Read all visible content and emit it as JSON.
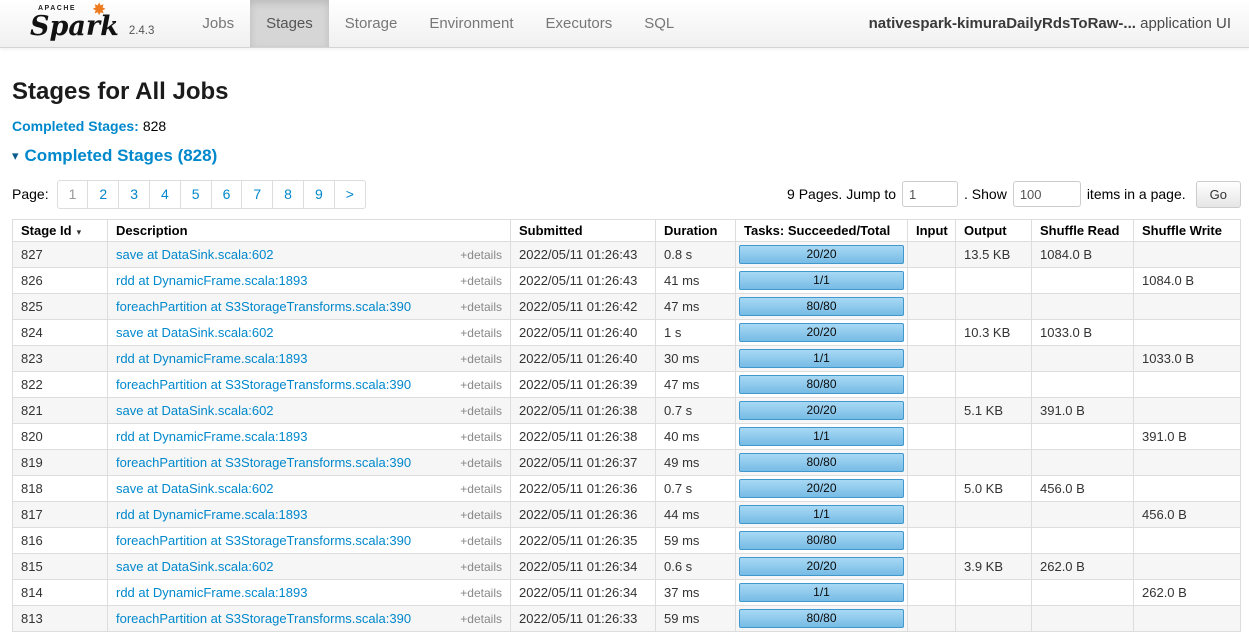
{
  "navbar": {
    "logo": {
      "apache": "APACHE",
      "name": "Spark",
      "version": "2.4.3"
    },
    "items": [
      {
        "label": "Jobs",
        "active": false
      },
      {
        "label": "Stages",
        "active": true
      },
      {
        "label": "Storage",
        "active": false
      },
      {
        "label": "Environment",
        "active": false
      },
      {
        "label": "Executors",
        "active": false
      },
      {
        "label": "SQL",
        "active": false
      }
    ],
    "app_name": "nativespark-kimuraDailyRdsToRaw-...",
    "app_suffix": "application UI"
  },
  "page": {
    "title": "Stages for All Jobs",
    "summary_label": "Completed Stages:",
    "summary_value": "828",
    "section_arrow": "▾",
    "section_title": "Completed Stages (828)"
  },
  "pagination": {
    "label": "Page:",
    "pages": [
      "1",
      "2",
      "3",
      "4",
      "5",
      "6",
      "7",
      "8",
      "9",
      ">"
    ],
    "current": "1",
    "right": {
      "pages_text": "9 Pages. Jump to",
      "jump_value": "1",
      "show_text": ". Show",
      "show_value": "100",
      "items_text": "items in a page.",
      "go_label": "Go"
    }
  },
  "colors": {
    "link_blue": "#0088cc",
    "progress_fill": "#77bbe5",
    "progress_border": "#4198cd",
    "active_tab": "#d6d6d6"
  },
  "table": {
    "columns": [
      "Stage Id",
      "Description",
      "Submitted",
      "Duration",
      "Tasks: Succeeded/Total",
      "Input",
      "Output",
      "Shuffle Read",
      "Shuffle Write"
    ],
    "sort_arrow": "▾",
    "details_label": "+details",
    "rows": [
      {
        "id": "827",
        "description": "save at DataSink.scala:602",
        "submitted": "2022/05/11 01:26:43",
        "duration": "0.8 s",
        "tasks": "20/20",
        "input": "",
        "output": "13.5 KB",
        "shuffle_read": "1084.0 B",
        "shuffle_write": ""
      },
      {
        "id": "826",
        "description": "rdd at DynamicFrame.scala:1893",
        "submitted": "2022/05/11 01:26:43",
        "duration": "41 ms",
        "tasks": "1/1",
        "input": "",
        "output": "",
        "shuffle_read": "",
        "shuffle_write": "1084.0 B"
      },
      {
        "id": "825",
        "description": "foreachPartition at S3StorageTransforms.scala:390",
        "submitted": "2022/05/11 01:26:42",
        "duration": "47 ms",
        "tasks": "80/80",
        "input": "",
        "output": "",
        "shuffle_read": "",
        "shuffle_write": ""
      },
      {
        "id": "824",
        "description": "save at DataSink.scala:602",
        "submitted": "2022/05/11 01:26:40",
        "duration": "1 s",
        "tasks": "20/20",
        "input": "",
        "output": "10.3 KB",
        "shuffle_read": "1033.0 B",
        "shuffle_write": ""
      },
      {
        "id": "823",
        "description": "rdd at DynamicFrame.scala:1893",
        "submitted": "2022/05/11 01:26:40",
        "duration": "30 ms",
        "tasks": "1/1",
        "input": "",
        "output": "",
        "shuffle_read": "",
        "shuffle_write": "1033.0 B"
      },
      {
        "id": "822",
        "description": "foreachPartition at S3StorageTransforms.scala:390",
        "submitted": "2022/05/11 01:26:39",
        "duration": "47 ms",
        "tasks": "80/80",
        "input": "",
        "output": "",
        "shuffle_read": "",
        "shuffle_write": ""
      },
      {
        "id": "821",
        "description": "save at DataSink.scala:602",
        "submitted": "2022/05/11 01:26:38",
        "duration": "0.7 s",
        "tasks": "20/20",
        "input": "",
        "output": "5.1 KB",
        "shuffle_read": "391.0 B",
        "shuffle_write": ""
      },
      {
        "id": "820",
        "description": "rdd at DynamicFrame.scala:1893",
        "submitted": "2022/05/11 01:26:38",
        "duration": "40 ms",
        "tasks": "1/1",
        "input": "",
        "output": "",
        "shuffle_read": "",
        "shuffle_write": "391.0 B"
      },
      {
        "id": "819",
        "description": "foreachPartition at S3StorageTransforms.scala:390",
        "submitted": "2022/05/11 01:26:37",
        "duration": "49 ms",
        "tasks": "80/80",
        "input": "",
        "output": "",
        "shuffle_read": "",
        "shuffle_write": ""
      },
      {
        "id": "818",
        "description": "save at DataSink.scala:602",
        "submitted": "2022/05/11 01:26:36",
        "duration": "0.7 s",
        "tasks": "20/20",
        "input": "",
        "output": "5.0 KB",
        "shuffle_read": "456.0 B",
        "shuffle_write": ""
      },
      {
        "id": "817",
        "description": "rdd at DynamicFrame.scala:1893",
        "submitted": "2022/05/11 01:26:36",
        "duration": "44 ms",
        "tasks": "1/1",
        "input": "",
        "output": "",
        "shuffle_read": "",
        "shuffle_write": "456.0 B"
      },
      {
        "id": "816",
        "description": "foreachPartition at S3StorageTransforms.scala:390",
        "submitted": "2022/05/11 01:26:35",
        "duration": "59 ms",
        "tasks": "80/80",
        "input": "",
        "output": "",
        "shuffle_read": "",
        "shuffle_write": ""
      },
      {
        "id": "815",
        "description": "save at DataSink.scala:602",
        "submitted": "2022/05/11 01:26:34",
        "duration": "0.6 s",
        "tasks": "20/20",
        "input": "",
        "output": "3.9 KB",
        "shuffle_read": "262.0 B",
        "shuffle_write": ""
      },
      {
        "id": "814",
        "description": "rdd at DynamicFrame.scala:1893",
        "submitted": "2022/05/11 01:26:34",
        "duration": "37 ms",
        "tasks": "1/1",
        "input": "",
        "output": "",
        "shuffle_read": "",
        "shuffle_write": "262.0 B"
      },
      {
        "id": "813",
        "description": "foreachPartition at S3StorageTransforms.scala:390",
        "submitted": "2022/05/11 01:26:33",
        "duration": "59 ms",
        "tasks": "80/80",
        "input": "",
        "output": "",
        "shuffle_read": "",
        "shuffle_write": ""
      }
    ]
  }
}
